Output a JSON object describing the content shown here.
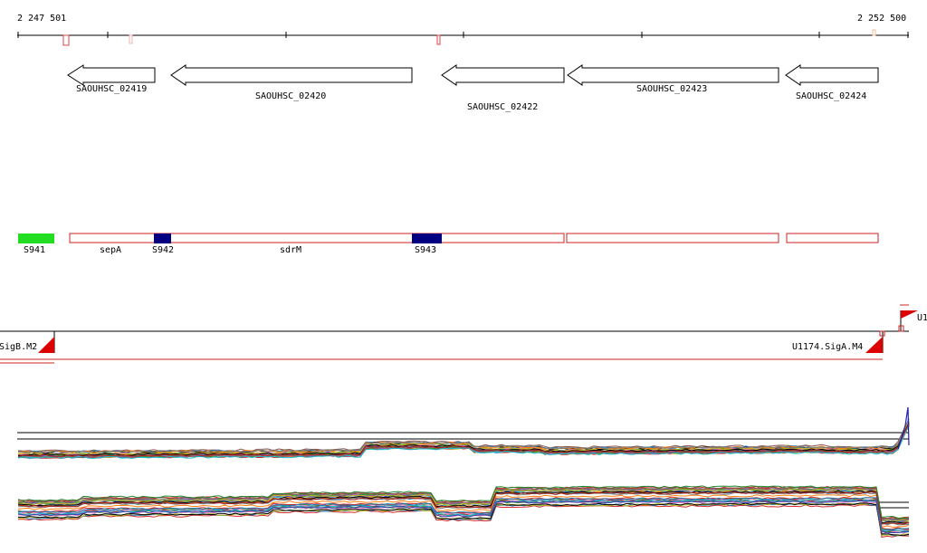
{
  "ruler": {
    "start_label": "2 247 501",
    "end_label": "2 252 500"
  },
  "genes": [
    {
      "label": "SAOUHSC_02419"
    },
    {
      "label": "SAOUHSC_02420"
    },
    {
      "label": "SAOUHSC_02422"
    },
    {
      "label": "SAOUHSC_02423"
    },
    {
      "label": "SAOUHSC_02424"
    }
  ],
  "features": [
    {
      "label": "S941",
      "kind": "segment",
      "color": "#22dd22"
    },
    {
      "label": "sepA",
      "kind": "annotation",
      "color": "#cc2222"
    },
    {
      "label": "S942",
      "kind": "segment",
      "color": "#000080"
    },
    {
      "label": "sdrM",
      "kind": "annotation",
      "color": "#cc2222"
    },
    {
      "label": "S943",
      "kind": "segment",
      "color": "#000080"
    }
  ],
  "promoters": [
    {
      "label": "SigB.M2"
    },
    {
      "label": "U1174.SigA.M4"
    },
    {
      "label": "U1"
    }
  ],
  "colors": {
    "gene_outline": "#000000",
    "annotation_outline": "#cc2222",
    "promoter_flag": "#dd0000",
    "axis": "#000000"
  }
}
